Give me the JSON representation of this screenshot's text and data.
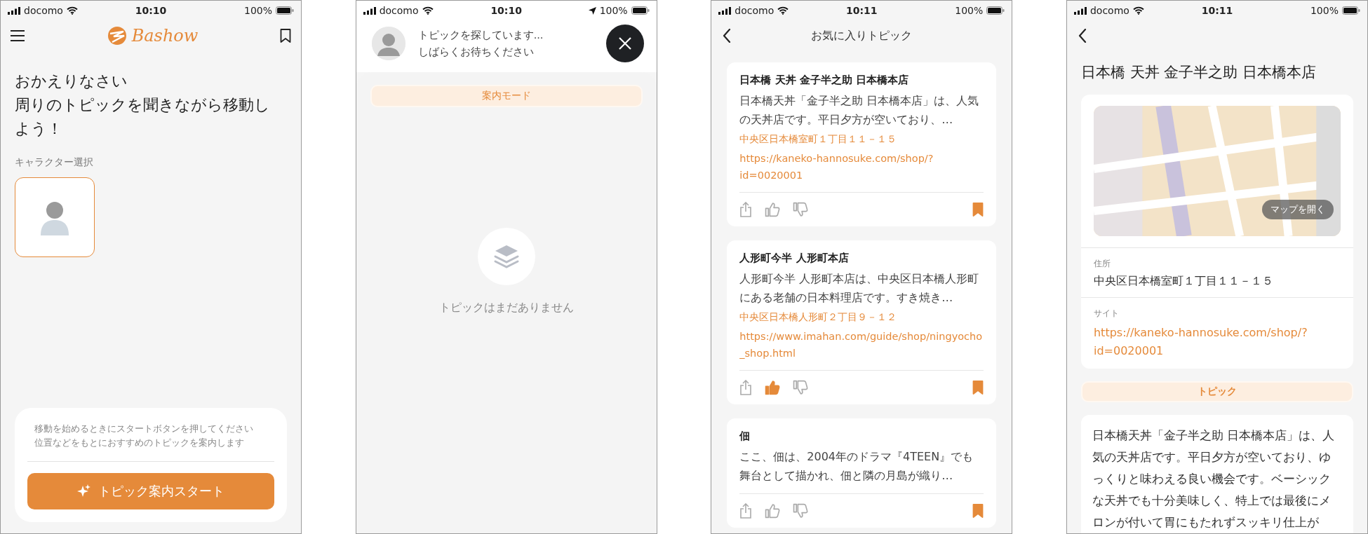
{
  "home_screen": {
    "status_bar": {
      "carrier": "docomo",
      "time": "10:10",
      "battery": "100%",
      "location": false
    },
    "logo": "Bashow",
    "greeting": [
      "おかえりなさい",
      "周りのトピックを聞きながら移動しよう！"
    ],
    "character_label": "キャラクター選択",
    "characters": [
      {
        "selected": true
      }
    ],
    "hint": [
      "移動を始めるときにスタートボタンを押してください",
      "位置などをもとにおすすめのトピックを案内します"
    ],
    "start_button": "トピック案内スタート"
  },
  "search_screen": {
    "status_bar": {
      "carrier": "docomo",
      "time": "10:10",
      "battery": "100%",
      "location": true
    },
    "message": [
      "トピックを探しています...",
      "しばらくお待ちください"
    ],
    "mode": "案内モード",
    "empty_message": "トピックはまだありません"
  },
  "favorites_screen": {
    "status_bar": {
      "carrier": "docomo",
      "time": "10:11",
      "battery": "100%",
      "location": false
    },
    "title": "お気に入りトピック",
    "topics": [
      {
        "title": "日本橋 天丼 金子半之助 日本橋本店",
        "summary": "日本橋天丼「金子半之助 日本橋本店」は、人気の天丼店です。平日夕方が空いており、…",
        "address": "中央区日本橋室町１丁目１１－１５",
        "url": "https://kaneko-hannosuke.com/shop/?id=0020001",
        "liked": false,
        "bookmarked": true
      },
      {
        "title": "人形町今半 人形町本店",
        "summary": "人形町今半 人形町本店は、中央区日本橋人形町にある老舗の日本料理店です。すき焼き…",
        "address": "中央区日本橋人形町２丁目９－１２",
        "url": "https://www.imahan.com/guide/shop/ningyocho_shop.html",
        "liked": true,
        "bookmarked": true
      },
      {
        "title": "佃",
        "summary": "ここ、佃は、2004年のドラマ『4TEEN』でも舞台として描かれ、佃と隣の月島が織り…",
        "liked": false,
        "bookmarked": true
      }
    ]
  },
  "detail_screen": {
    "status_bar": {
      "carrier": "docomo",
      "time": "10:11",
      "battery": "100%",
      "location": false
    },
    "title": "日本橋 天丼 金子半之助 日本橋本店",
    "map_button": "マップを開く",
    "address_label": "住所",
    "address": "中央区日本橋室町１丁目１１－１５",
    "site_label": "サイト",
    "site": "https://kaneko-hannosuke.com/shop/?id=0020001",
    "section": "トピック",
    "body": "日本橋天丼「金子半之助 日本橋本店」は、人気の天丼店です。平日夕方が空いており、ゆっくりと味わえる良い機会です。ベーシックな天丼でも十分美味しく、特上では最後にメロンが付いて胃にもたれずスッキリ仕上が"
  }
}
